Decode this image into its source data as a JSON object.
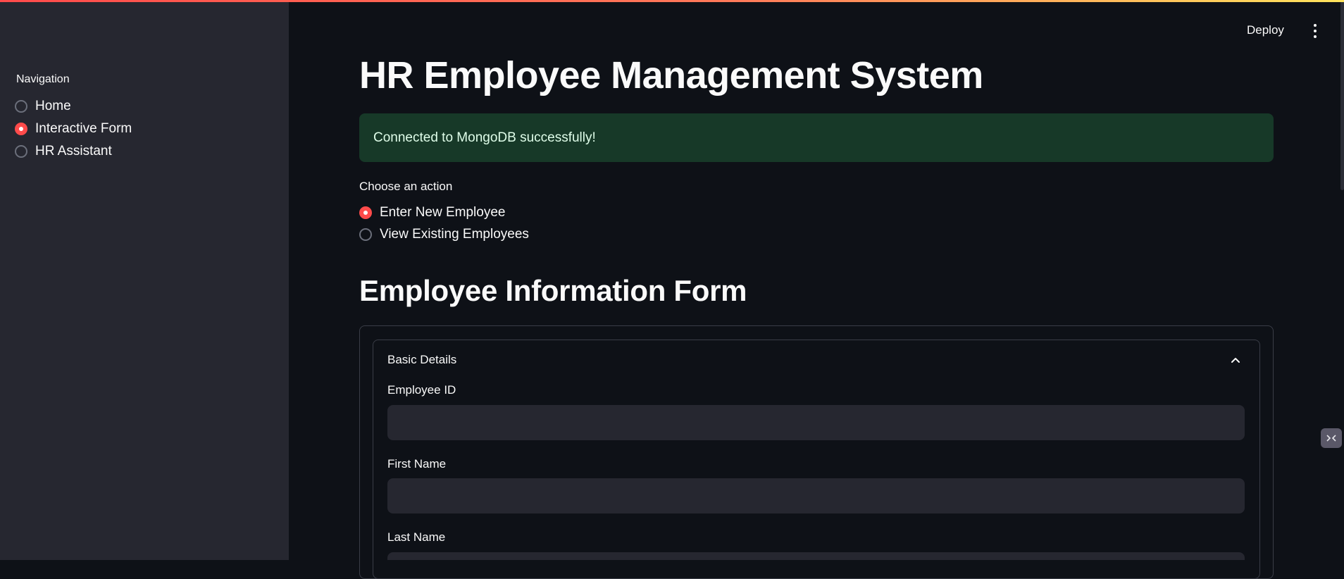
{
  "sidebar": {
    "nav_label": "Navigation",
    "items": [
      {
        "label": "Home",
        "checked": false
      },
      {
        "label": "Interactive Form",
        "checked": true
      },
      {
        "label": "HR Assistant",
        "checked": false
      }
    ]
  },
  "header": {
    "deploy_label": "Deploy",
    "menu_icon": "kebab-menu-icon"
  },
  "main": {
    "title": "HR Employee Management System",
    "alert_text": "Connected to MongoDB successfully!",
    "action_label": "Choose an action",
    "actions": [
      {
        "label": "Enter New Employee",
        "checked": true
      },
      {
        "label": "View Existing Employees",
        "checked": false
      }
    ],
    "form_title": "Employee Information Form",
    "expander": {
      "title": "Basic Details",
      "chevron_icon": "chevron-up-icon",
      "fields": [
        {
          "label": "Employee ID",
          "value": ""
        },
        {
          "label": "First Name",
          "value": ""
        },
        {
          "label": "Last Name",
          "value": ""
        }
      ]
    }
  },
  "colors": {
    "background": "#0e1117",
    "sidebar": "#262730",
    "accent": "#ff4b4b",
    "success_bg": "#173928",
    "input_bg": "#262730"
  }
}
